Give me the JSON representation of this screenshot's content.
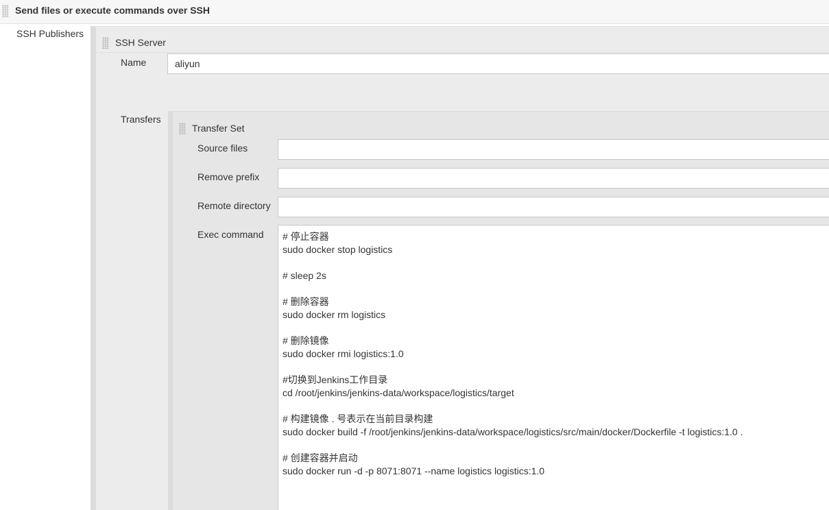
{
  "section": {
    "title": "Send files or execute commands over SSH"
  },
  "publishers": {
    "label": "SSH Publishers"
  },
  "server": {
    "title": "SSH Server",
    "name_label": "Name",
    "name_value": "aliyun"
  },
  "transfers": {
    "label": "Transfers"
  },
  "transfer_set": {
    "title": "Transfer Set",
    "source_files_label": "Source files",
    "source_files_value": "",
    "remove_prefix_label": "Remove prefix",
    "remove_prefix_value": "",
    "remote_directory_label": "Remote directory",
    "remote_directory_value": "",
    "exec_command_label": "Exec command",
    "exec_command_lines": [
      "# 停止容器",
      "sudo docker stop logistics",
      "",
      "# sleep 2s",
      "",
      "# 删除容器",
      "sudo docker rm logistics",
      "",
      "# 删除镜像",
      "sudo docker rmi logistics:1.0",
      "",
      "#切换到Jenkins工作目录",
      "cd /root/jenkins/jenkins-data/workspace/logistics/target",
      "",
      "# 构建镜像 . 号表示在当前目录构建",
      "sudo docker build -f /root/jenkins/jenkins-data/workspace/logistics/src/main/docker/Dockerfile -t logistics:1.0 .",
      "",
      "# 创建容器并启动",
      "sudo docker run -d -p 8071:8071 --name logistics logistics:1.0"
    ]
  }
}
